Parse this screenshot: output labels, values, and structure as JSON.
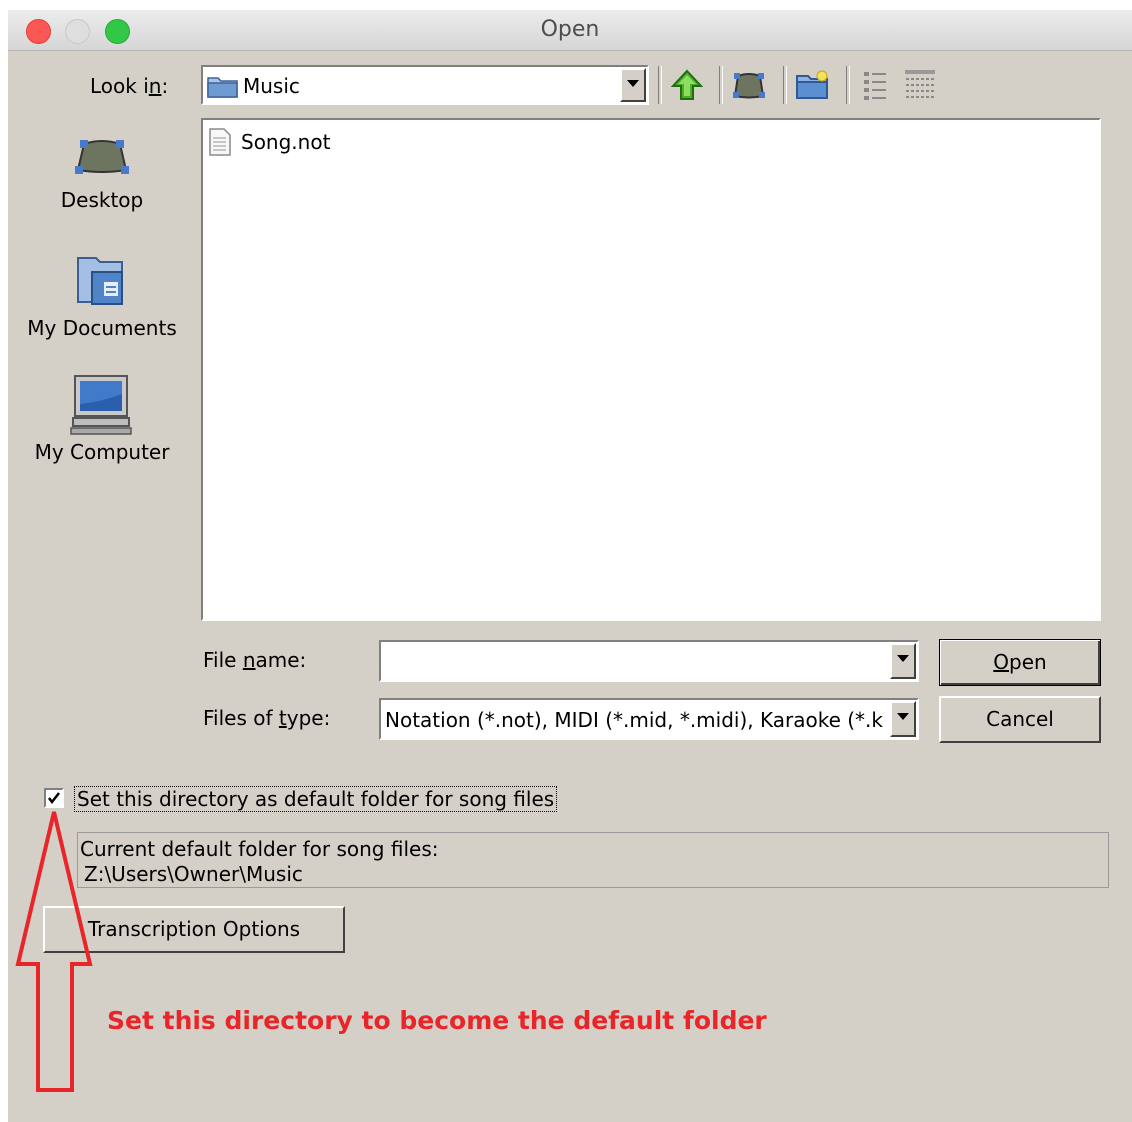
{
  "window": {
    "title": "Open"
  },
  "look_in": {
    "label": "Look in:",
    "value": "Music"
  },
  "toolbar": {
    "icons": [
      "up-folder-icon",
      "desktop-icon",
      "new-folder-icon",
      "list-view-icon",
      "details-view-icon"
    ]
  },
  "places": [
    {
      "label": "Desktop",
      "icon": "desktop-icon"
    },
    {
      "label": "My Documents",
      "icon": "my-documents-icon"
    },
    {
      "label": "My Computer",
      "icon": "my-computer-icon"
    }
  ],
  "files": [
    {
      "name": "Song.not",
      "icon": "document-icon"
    }
  ],
  "file_name": {
    "label": "File name:",
    "value": ""
  },
  "files_of_type": {
    "label": "Files of type:",
    "value": "Notation (*.not), MIDI (*.mid, *.midi), Karaoke (*.k"
  },
  "buttons": {
    "open": "Open",
    "cancel": "Cancel",
    "transcription": "Transcription Options"
  },
  "default_checkbox": {
    "label": "Set this directory as default folder for song files",
    "checked": true
  },
  "current_default": {
    "label": "Current default folder for song files:",
    "path": "Z:\\Users\\Owner\\Music"
  },
  "annotation": {
    "text": "Set this directory to become the default folder",
    "color": "#e8262a"
  },
  "colors": {
    "dialog_bg": "#d4d0c8",
    "close": "#fc5753",
    "minimize": "#dedede",
    "zoom": "#33c748"
  }
}
